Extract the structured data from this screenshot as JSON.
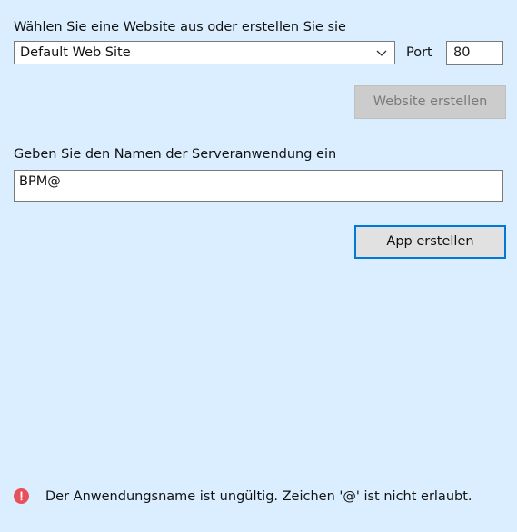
{
  "website_section": {
    "label": "Wählen Sie eine Website aus oder erstellen Sie sie",
    "selected_site": "Default Web Site",
    "port_label": "Port",
    "port_value": "80",
    "create_site_button": "Website erstellen"
  },
  "app_section": {
    "label": "Geben Sie den Namen der Serveranwendung ein",
    "app_name_value": "BPM@",
    "create_app_button": "App erstellen"
  },
  "validation": {
    "message": "Der Anwendungsname ist ungültig. Zeichen '@' ist nicht erlaubt.",
    "icon": "error-icon"
  },
  "colors": {
    "background": "#daeeff",
    "accent": "#0078d7",
    "error": "#e8505b"
  }
}
